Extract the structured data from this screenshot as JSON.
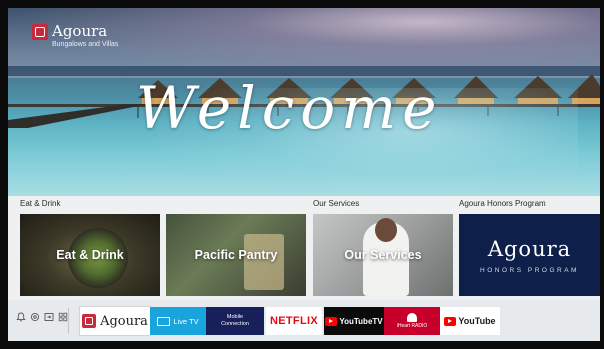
{
  "brand": {
    "name": "Agoura",
    "subtitle": "Bungalows and Villas"
  },
  "hero": {
    "welcome_text": "Welcome"
  },
  "sections": {
    "eat_drink_label": "Eat & Drink",
    "our_services_label": "Our Services",
    "honors_label": "Agoura Honors Program"
  },
  "cards": [
    {
      "title": "Eat & Drink"
    },
    {
      "title": "Pacific Pantry"
    },
    {
      "title": "Our Services"
    },
    {
      "name": "Agoura",
      "subtitle": "HONORS PROGRAM"
    }
  ],
  "dock": {
    "system_icons": [
      "bell-icon",
      "settings-icon",
      "input-source-icon",
      "apps-grid-icon"
    ],
    "apps": {
      "agoura": "Agoura",
      "live_tv": "Live TV",
      "mobile_line1": "Mobile",
      "mobile_line2": "Connection",
      "netflix": "NETFLIX",
      "youtube_tv": "YouTubeTV",
      "iheart": "iHeart RADIO",
      "youtube": "YouTube"
    }
  },
  "colors": {
    "brand_red": "#c52b3a",
    "honors_navy": "#0e1f4a",
    "live_tv_blue": "#1aa4dc",
    "mobile_navy": "#17205a",
    "netflix_red": "#e50914",
    "iheart_red": "#c6002b"
  }
}
